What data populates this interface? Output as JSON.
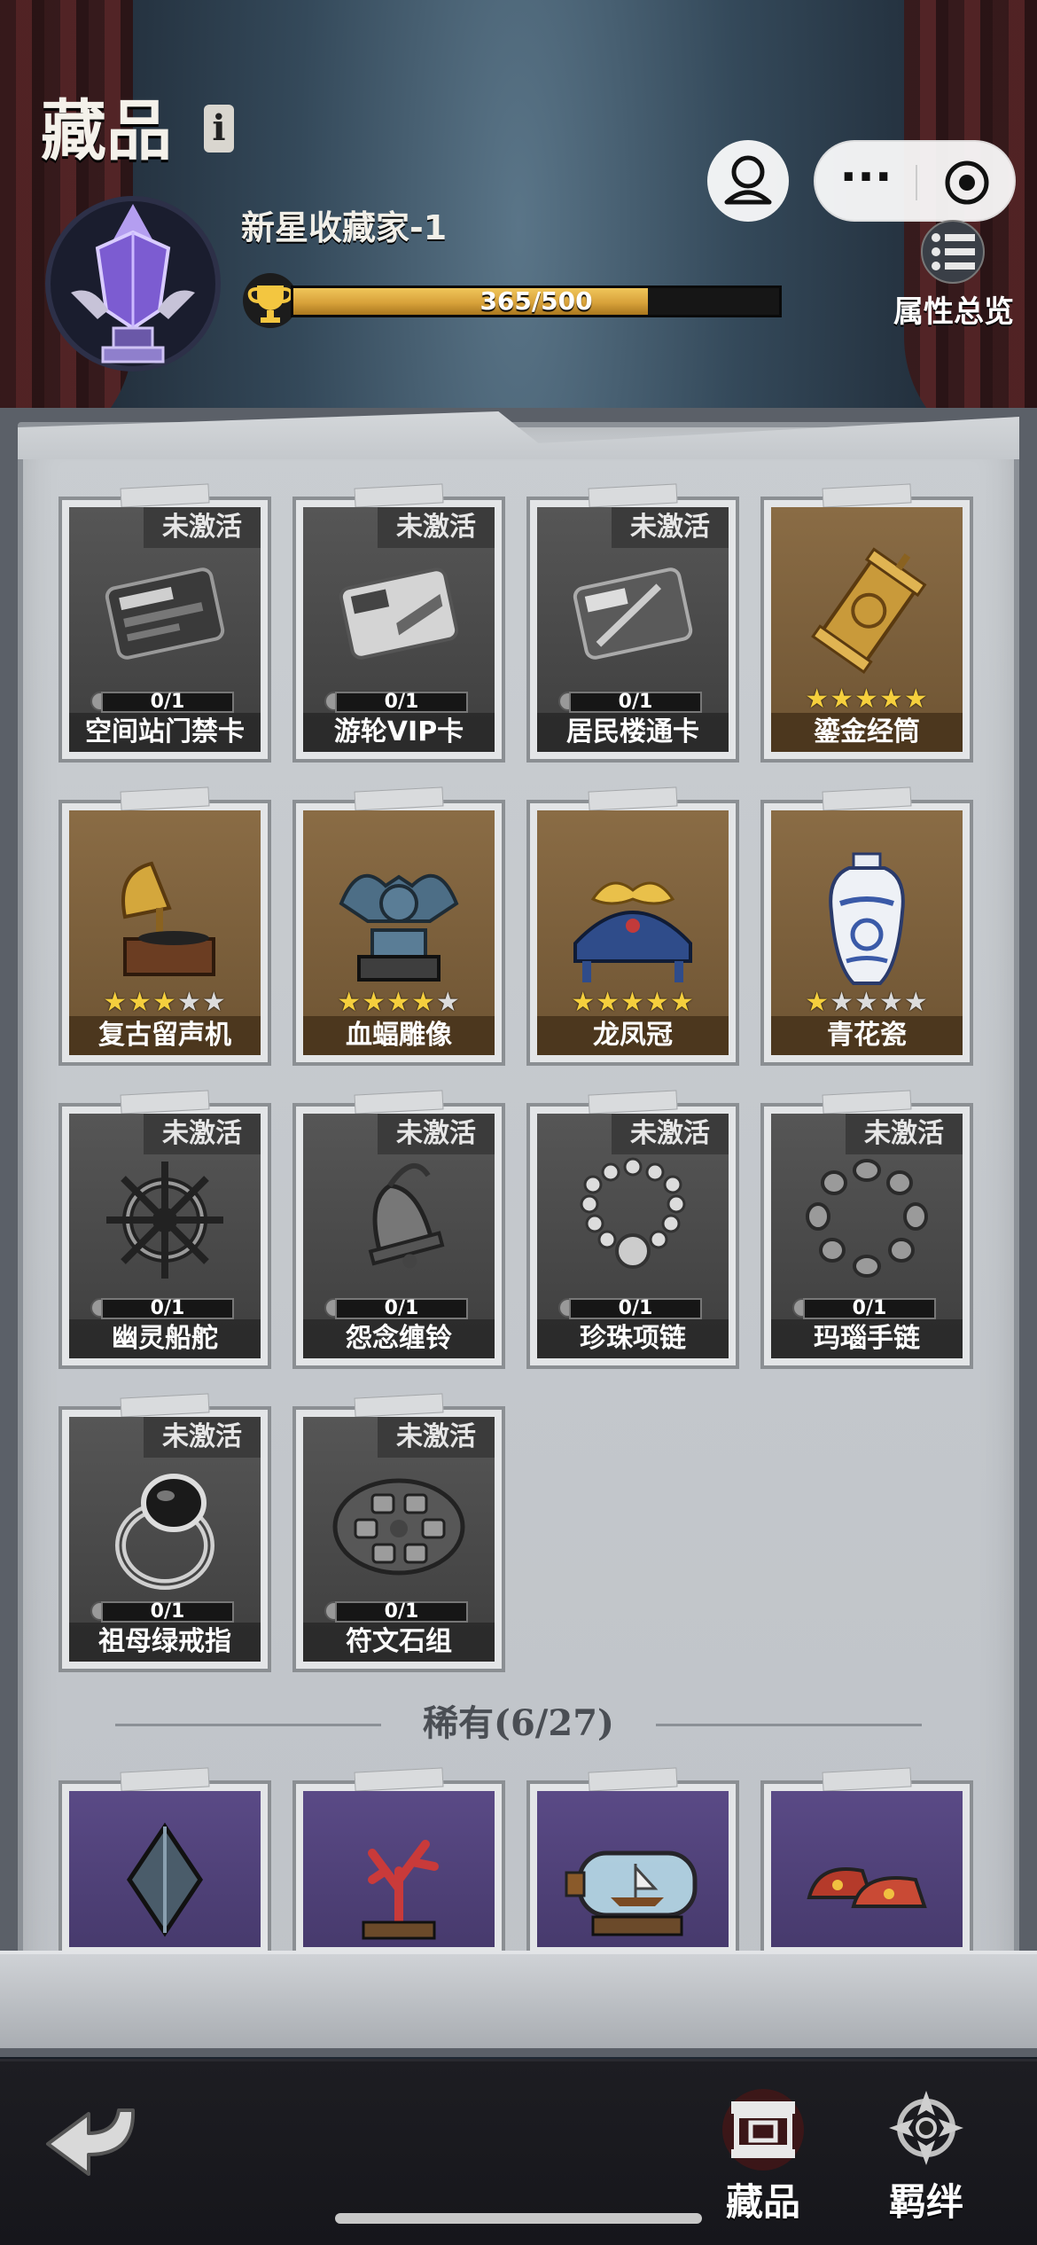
{
  "header": {
    "title": "藏品",
    "info_icon": "i",
    "collector_title": "新星收藏家-1",
    "progress": {
      "current": 365,
      "max": 500,
      "text": "365/500"
    }
  },
  "top_controls": {
    "more_glyph": "···",
    "attributes_label": "属性总览"
  },
  "status_inactive": "未激活",
  "cards": [
    {
      "name": "空间站门禁卡",
      "state": "inactive",
      "progress": "0/1",
      "icon": "access-card-icon"
    },
    {
      "name": "游轮VIP卡",
      "state": "inactive",
      "progress": "0/1",
      "icon": "vip-card-icon"
    },
    {
      "name": "居民楼通卡",
      "state": "inactive",
      "progress": "0/1",
      "icon": "resident-card-icon"
    },
    {
      "name": "鎏金经筒",
      "state": "gold",
      "stars": 5,
      "icon": "prayer-wheel-icon"
    },
    {
      "name": "复古留声机",
      "state": "gold",
      "stars": 3,
      "icon": "gramophone-icon"
    },
    {
      "name": "血蝠雕像",
      "state": "gold",
      "stars": 4,
      "icon": "gargoyle-statue-icon"
    },
    {
      "name": "龙凤冠",
      "state": "gold",
      "stars": 5,
      "icon": "phoenix-crown-icon"
    },
    {
      "name": "青花瓷",
      "state": "gold",
      "stars": 1,
      "icon": "porcelain-vase-icon"
    },
    {
      "name": "幽灵船舵",
      "state": "inactive",
      "progress": "0/1",
      "icon": "ship-wheel-icon"
    },
    {
      "name": "怨念缠铃",
      "state": "inactive",
      "progress": "0/1",
      "icon": "bell-icon"
    },
    {
      "name": "珍珠项链",
      "state": "inactive",
      "progress": "0/1",
      "icon": "pearl-necklace-icon"
    },
    {
      "name": "玛瑙手链",
      "state": "inactive",
      "progress": "0/1",
      "icon": "agate-bracelet-icon"
    },
    {
      "name": "祖母绿戒指",
      "state": "inactive",
      "progress": "0/1",
      "icon": "emerald-ring-icon"
    },
    {
      "name": "符文石组",
      "state": "inactive",
      "progress": "0/1",
      "icon": "rune-stones-icon"
    }
  ],
  "rare_section": {
    "title": "稀有(6/27)",
    "items": [
      {
        "icon": "crystal-shard-icon"
      },
      {
        "icon": "coral-icon"
      },
      {
        "icon": "ship-in-bottle-icon"
      },
      {
        "icon": "embroidered-shoes-icon"
      }
    ]
  },
  "bottom_nav": {
    "back_icon": "back-arrow-icon",
    "tabs": [
      {
        "label": "藏品",
        "icon": "collection-icon",
        "active": true
      },
      {
        "label": "羁绊",
        "icon": "bond-icon",
        "active": false
      }
    ]
  },
  "colors": {
    "progress_gold": "#d8a23a",
    "star_on": "#f5cf3d",
    "star_off": "#dcdcdc",
    "inactive_card": "#4a4a4a",
    "gold_card": "#7a5f3c",
    "purple_card": "#4f4178"
  }
}
